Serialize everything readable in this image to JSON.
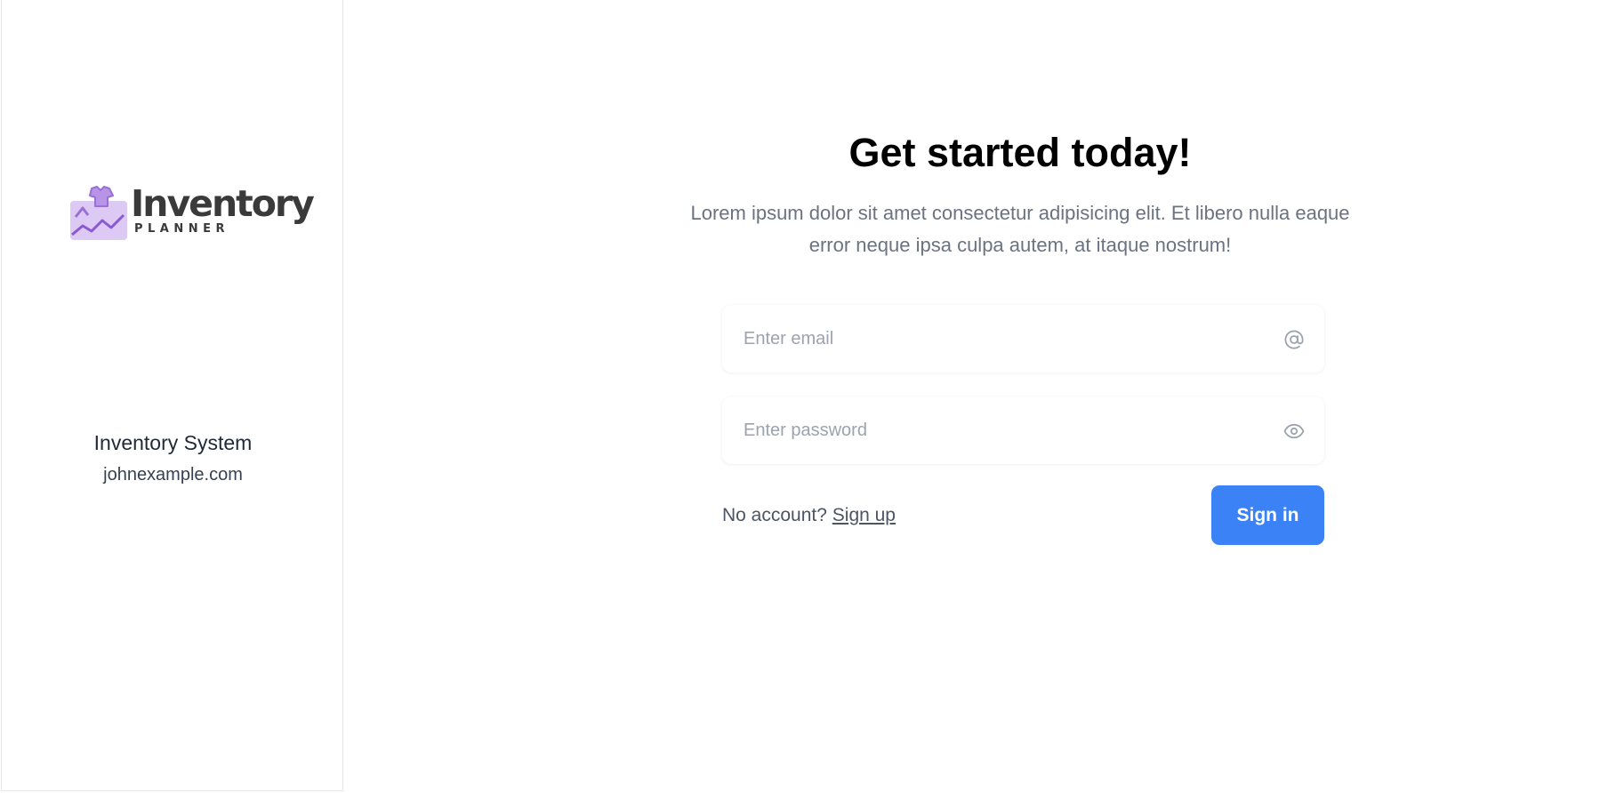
{
  "sidebar": {
    "logo": {
      "word": "Inventory",
      "sub": "PLANNER"
    },
    "org_name": "Inventory System",
    "org_domain": "johnexample.com"
  },
  "main": {
    "headline": "Get started today!",
    "lede": "Lorem ipsum dolor sit amet consectetur adipisicing elit. Et libero nulla eaque error neque ipsa culpa autem, at itaque nostrum!",
    "email": {
      "placeholder": "Enter email",
      "value": "",
      "icon": "at-sign-icon"
    },
    "password": {
      "placeholder": "Enter password",
      "value": "",
      "icon": "eye-icon"
    },
    "no_account_text": "No account?",
    "signup_label": "Sign up",
    "signin_label": "Sign in"
  },
  "colors": {
    "primary": "#3b82f6",
    "logo_purple": "#9b6fd8",
    "text_muted": "#6b7280"
  }
}
